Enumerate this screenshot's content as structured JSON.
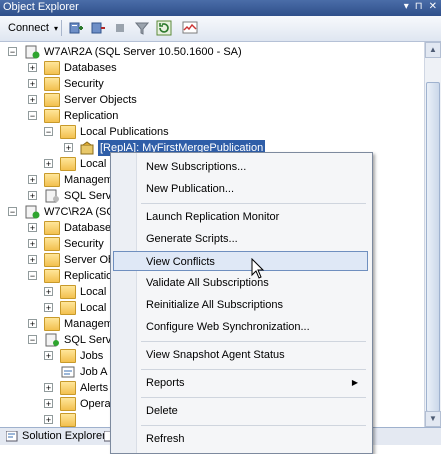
{
  "window": {
    "title": "Object Explorer",
    "pin_glyph": "▾",
    "pin2_glyph": "⊓",
    "close_glyph": "✕"
  },
  "toolbar": {
    "connect_label": "Connect",
    "connect_dd": "▾"
  },
  "tree": {
    "server1": "W7A\\R2A (SQL Server 10.50.1600 - SA)",
    "s1_databases": "Databases",
    "s1_security": "Security",
    "s1_server_objects": "Server Objects",
    "s1_replication": "Replication",
    "s1_local_publications": "Local Publications",
    "s1_publication": "[ReplA]: MyFirstMergePublication",
    "s1_local_partial": "Local",
    "s1_management_partial": "Managem",
    "s1_sqlserver_partial": "SQL Serve",
    "server2_partial": "W7C\\R2A (SQ",
    "s2_databases_partial": "Database",
    "s2_security": "Security",
    "s2_server_obj_partial": "Server Ob",
    "s2_replication_partial": "Replicatio",
    "s2_local1": "Local",
    "s2_local2": "Local",
    "s2_management_partial": "Managem",
    "s2_sqlserver_partial": "SQL Serve",
    "s2_jobs": "Jobs",
    "s2_joba_partial": "Job A",
    "s2_alerts_partial": "Alerts",
    "s2_opera_partial": "Opera",
    "expand_plus": "+",
    "expand_minus": "−"
  },
  "menu": {
    "items": [
      "New Subscriptions...",
      "New Publication...",
      "Launch Replication Monitor",
      "Generate Scripts...",
      "View Conflicts",
      "Validate All Subscriptions",
      "Reinitialize All Subscriptions",
      "Configure Web Synchronization...",
      "View Snapshot Agent Status",
      "Reports",
      "Delete",
      "Refresh"
    ],
    "submenu_arrow": "▶"
  },
  "scrollbar": {
    "up": "▲",
    "down": "▼"
  },
  "tabs": {
    "solution_explorer": "Solution Explorer"
  },
  "colors": {
    "selection": "#2f5ea8",
    "menu_highlight": "#dfe8f6"
  }
}
